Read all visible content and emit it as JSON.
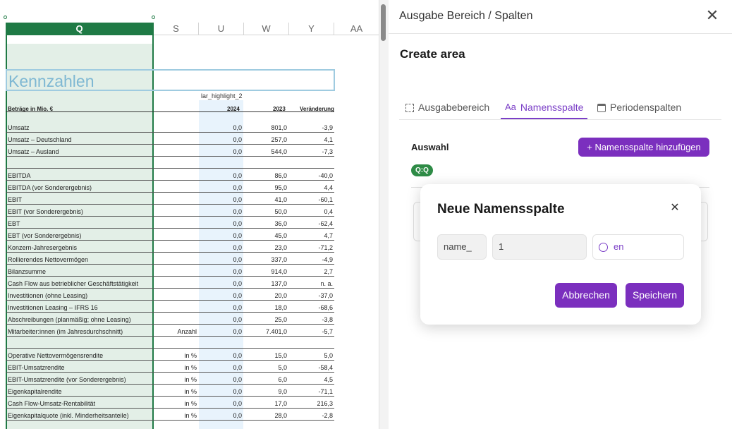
{
  "sheet": {
    "columns": [
      {
        "label": "Q",
        "active": true
      },
      {
        "label": "S"
      },
      {
        "label": "U"
      },
      {
        "label": "W"
      },
      {
        "label": "Y"
      },
      {
        "label": "AA"
      }
    ],
    "title": "Kennzahlen",
    "highlight_label": "lar_highlight_2",
    "header": {
      "label": "Beträge in Mio. €",
      "c1": "2024",
      "c2": "2023",
      "c3": "Veränderung"
    },
    "rows": [
      {
        "label": "Umsatz",
        "unit": "",
        "v1": "0,0",
        "v2": "801,0",
        "v3": "-3,9"
      },
      {
        "label": "Umsatz – Deutschland",
        "unit": "",
        "v1": "0,0",
        "v2": "257,0",
        "v3": "4,1"
      },
      {
        "label": "Umsatz – Ausland",
        "unit": "",
        "v1": "0,0",
        "v2": "544,0",
        "v3": "-7,3"
      },
      {
        "label": "",
        "unit": "",
        "v1": "",
        "v2": "",
        "v3": ""
      },
      {
        "label": "EBITDA",
        "unit": "",
        "v1": "0,0",
        "v2": "86,0",
        "v3": "-40,0"
      },
      {
        "label": "EBITDA (vor Sonderergebnis)",
        "unit": "",
        "v1": "0,0",
        "v2": "95,0",
        "v3": "4,4"
      },
      {
        "label": "EBIT",
        "unit": "",
        "v1": "0,0",
        "v2": "41,0",
        "v3": "-60,1"
      },
      {
        "label": "EBIT (vor Sonderergebnis)",
        "unit": "",
        "v1": "0,0",
        "v2": "50,0",
        "v3": "0,4"
      },
      {
        "label": "EBT",
        "unit": "",
        "v1": "0,0",
        "v2": "36,0",
        "v3": "-62,4"
      },
      {
        "label": "EBT (vor Sonderergebnis)",
        "unit": "",
        "v1": "0,0",
        "v2": "45,0",
        "v3": "4,7"
      },
      {
        "label": "Konzern-Jahresergebnis",
        "unit": "",
        "v1": "0,0",
        "v2": "23,0",
        "v3": "-71,2"
      },
      {
        "label": "Rollierendes Nettovermögen",
        "unit": "",
        "v1": "0,0",
        "v2": "337,0",
        "v3": "-4,9"
      },
      {
        "label": "Bilanzsumme",
        "unit": "",
        "v1": "0,0",
        "v2": "914,0",
        "v3": "2,7"
      },
      {
        "label": "Cash Flow aus betrieblicher Geschäftstätigkeit",
        "unit": "",
        "v1": "0,0",
        "v2": "137,0",
        "v3": "n. a."
      },
      {
        "label": "Investitionen (ohne Leasing)",
        "unit": "",
        "v1": "0,0",
        "v2": "20,0",
        "v3": "-37,0"
      },
      {
        "label": "Investitionen Leasing – IFRS 16",
        "unit": "",
        "v1": "0,0",
        "v2": "18,0",
        "v3": "-68,6"
      },
      {
        "label": "Abschreibungen (planmäßig; ohne Leasing)",
        "unit": "",
        "v1": "0,0",
        "v2": "25,0",
        "v3": "-3,8"
      },
      {
        "label": "Mitarbeiter:innen (im Jahresdurchschnitt)",
        "unit": "Anzahl",
        "v1": "0,0",
        "v2": "7.401,0",
        "v3": "-5,7"
      },
      {
        "label": "",
        "unit": "",
        "v1": "",
        "v2": "",
        "v3": ""
      },
      {
        "label": "Operative Nettovermögensrendite",
        "unit": "in %",
        "v1": "0,0",
        "v2": "15,0",
        "v3": "5,0"
      },
      {
        "label": "EBIT-Umsatzrendite",
        "unit": "in %",
        "v1": "0,0",
        "v2": "5,0",
        "v3": "-58,4"
      },
      {
        "label": "EBIT-Umsatzrendite (vor Sonderergebnis)",
        "unit": "in %",
        "v1": "0,0",
        "v2": "6,0",
        "v3": "4,5"
      },
      {
        "label": "Eigenkapitalrendite",
        "unit": "in %",
        "v1": "0,0",
        "v2": "9,0",
        "v3": "-71,1"
      },
      {
        "label": "Cash Flow-Umsatz-Rentabilität",
        "unit": "in %",
        "v1": "0,0",
        "v2": "17,0",
        "v3": "216,3"
      },
      {
        "label": "Eigenkapitalquote (inkl. Minderheitsanteile)",
        "unit": "in %",
        "v1": "0,0",
        "v2": "28,0",
        "v3": "-2,8"
      }
    ]
  },
  "panel": {
    "title": "Ausgabe Bereich / Spalten",
    "close_icon": "close-icon",
    "subtitle": "Create area",
    "tabs": [
      {
        "label": "Ausgabebereich",
        "icon": "dashed-square-icon",
        "active": false
      },
      {
        "label": "Namensspalte",
        "icon": "text-aa-icon",
        "active": true
      },
      {
        "label": "Periodenspalten",
        "icon": "calendar-icon",
        "active": false
      }
    ],
    "selection_label": "Auswahl",
    "add_button": "+ Namensspalte hinzufügen",
    "chip": "Q:Q"
  },
  "dialog": {
    "title": "Neue Namensspalte",
    "prefix": "name_",
    "number": "1",
    "language": "en",
    "language_icon": "language-icon",
    "cancel": "Abbrechen",
    "save": "Speichern"
  },
  "colors": {
    "excel_green": "#1f7a45",
    "accent_purple": "#7b2fbe",
    "chip_green": "#2e8b46",
    "highlight_blue": "#e8f3fc",
    "selection_fill": "#e3efe7"
  }
}
